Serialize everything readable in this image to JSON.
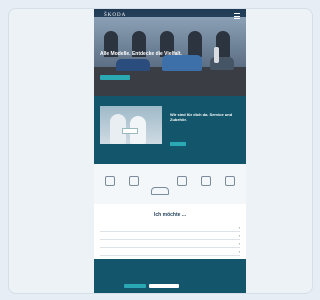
{
  "window": {
    "card_bg": "#edf2f7"
  },
  "hero": {
    "logo": "ŠKODA",
    "title": "Alle Modelle. Entdecke die Vielfalt.",
    "subtitle": "",
    "cta_label": ""
  },
  "promo": {
    "title": "Wir sind für dich da. Service und Zubehör.",
    "text": "",
    "cta_label": ""
  },
  "quick_links": [
    {
      "icon": "calculator-icon",
      "label": ""
    },
    {
      "icon": "brochure-icon",
      "label": ""
    },
    {
      "icon": "car-icon",
      "label": ""
    },
    {
      "icon": "dealer-icon",
      "label": ""
    },
    {
      "icon": "wrench-icon",
      "label": ""
    },
    {
      "icon": "steering-icon",
      "label": ""
    }
  ],
  "want": {
    "title": "Ich möchte ...",
    "rows": [
      {
        "label": ""
      },
      {
        "label": ""
      },
      {
        "label": ""
      },
      {
        "label": ""
      }
    ]
  },
  "cookie": {
    "title": "",
    "text": "",
    "accept_label": "",
    "settings_label": "",
    "reject_label": ""
  },
  "colors": {
    "teal": "#13566b",
    "accent": "#2aa8b3",
    "navy": "#1c3d5a"
  }
}
